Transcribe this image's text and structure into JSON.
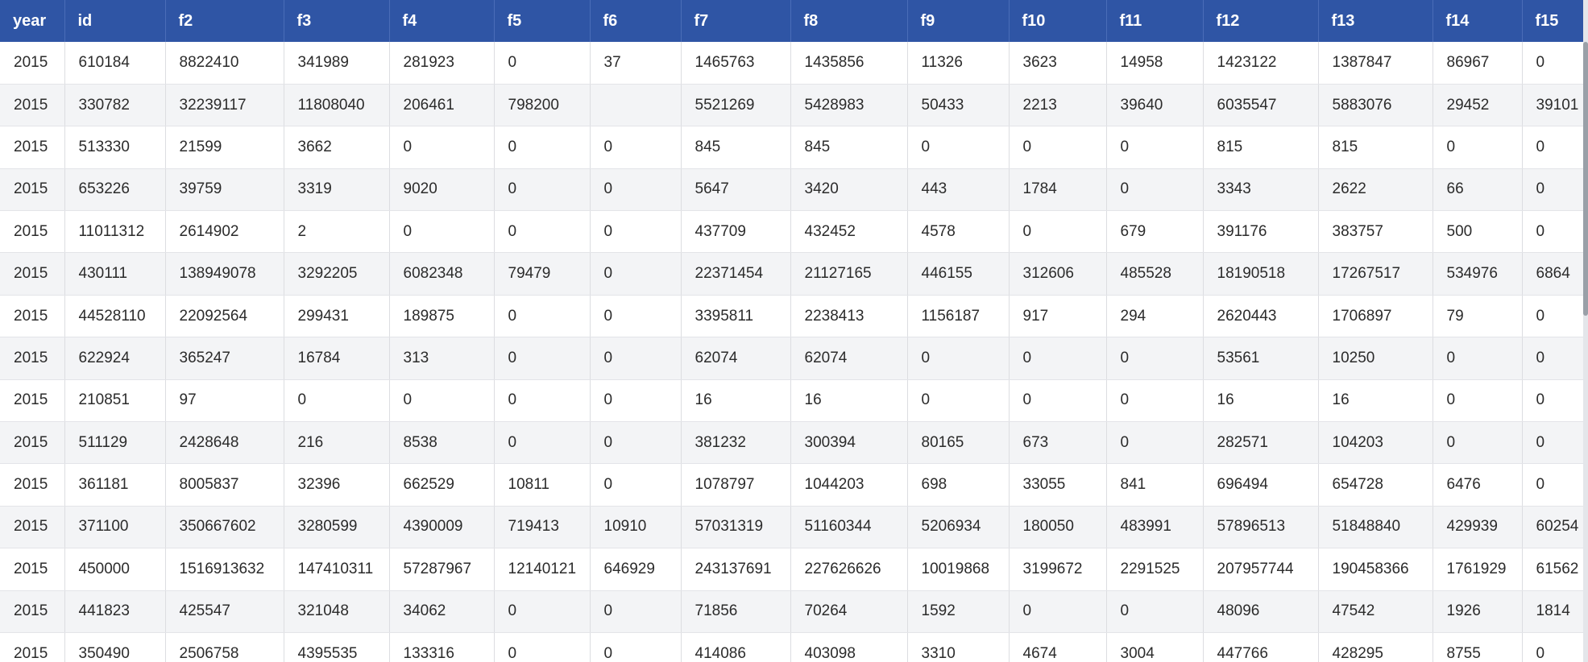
{
  "columns": [
    "year",
    "id",
    "f2",
    "f3",
    "f4",
    "f5",
    "f6",
    "f7",
    "f8",
    "f9",
    "f10",
    "f11",
    "f12",
    "f13",
    "f14",
    "f15"
  ],
  "rows": [
    [
      "2015",
      "610184",
      "8822410",
      "341989",
      "281923",
      "0",
      "37",
      "1465763",
      "1435856",
      "11326",
      "3623",
      "14958",
      "1423122",
      "1387847",
      "86967",
      "0"
    ],
    [
      "2015",
      "330782",
      "32239117",
      "11808040",
      "206461",
      "798200",
      "",
      "5521269",
      "5428983",
      "50433",
      "2213",
      "39640",
      "6035547",
      "5883076",
      "29452",
      "39101"
    ],
    [
      "2015",
      "513330",
      "21599",
      "3662",
      "0",
      "0",
      "0",
      "845",
      "845",
      "0",
      "0",
      "0",
      "815",
      "815",
      "0",
      "0"
    ],
    [
      "2015",
      "653226",
      "39759",
      "3319",
      "9020",
      "0",
      "0",
      "5647",
      "3420",
      "443",
      "1784",
      "0",
      "3343",
      "2622",
      "66",
      "0"
    ],
    [
      "2015",
      "11011312",
      "2614902",
      "2",
      "0",
      "0",
      "0",
      "437709",
      "432452",
      "4578",
      "0",
      "679",
      "391176",
      "383757",
      "500",
      "0"
    ],
    [
      "2015",
      "430111",
      "138949078",
      "3292205",
      "6082348",
      "79479",
      "0",
      "22371454",
      "21127165",
      "446155",
      "312606",
      "485528",
      "18190518",
      "17267517",
      "534976",
      "6864"
    ],
    [
      "2015",
      "44528110",
      "22092564",
      "299431",
      "189875",
      "0",
      "0",
      "3395811",
      "2238413",
      "1156187",
      "917",
      "294",
      "2620443",
      "1706897",
      "79",
      "0"
    ],
    [
      "2015",
      "622924",
      "365247",
      "16784",
      "313",
      "0",
      "0",
      "62074",
      "62074",
      "0",
      "0",
      "0",
      "53561",
      "10250",
      "0",
      "0"
    ],
    [
      "2015",
      "210851",
      "97",
      "0",
      "0",
      "0",
      "0",
      "16",
      "16",
      "0",
      "0",
      "0",
      "16",
      "16",
      "0",
      "0"
    ],
    [
      "2015",
      "511129",
      "2428648",
      "216",
      "8538",
      "0",
      "0",
      "381232",
      "300394",
      "80165",
      "673",
      "0",
      "282571",
      "104203",
      "0",
      "0"
    ],
    [
      "2015",
      "361181",
      "8005837",
      "32396",
      "662529",
      "10811",
      "0",
      "1078797",
      "1044203",
      "698",
      "33055",
      "841",
      "696494",
      "654728",
      "6476",
      "0"
    ],
    [
      "2015",
      "371100",
      "350667602",
      "3280599",
      "4390009",
      "719413",
      "10910",
      "57031319",
      "51160344",
      "5206934",
      "180050",
      "483991",
      "57896513",
      "51848840",
      "429939",
      "60254"
    ],
    [
      "2015",
      "450000",
      "1516913632",
      "147410311",
      "57287967",
      "12140121",
      "646929",
      "243137691",
      "227626626",
      "10019868",
      "3199672",
      "2291525",
      "207957744",
      "190458366",
      "1761929",
      "61562"
    ],
    [
      "2015",
      "441823",
      "425547",
      "321048",
      "34062",
      "0",
      "0",
      "71856",
      "70264",
      "1592",
      "0",
      "0",
      "48096",
      "47542",
      "1926",
      "1814"
    ],
    [
      "2015",
      "350490",
      "2506758",
      "4395535",
      "133316",
      "0",
      "0",
      "414086",
      "403098",
      "3310",
      "4674",
      "3004",
      "447766",
      "428295",
      "8755",
      "0"
    ]
  ]
}
